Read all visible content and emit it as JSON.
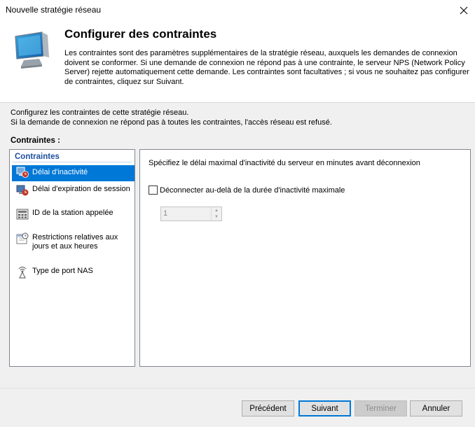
{
  "window": {
    "title": "Nouvelle stratégie réseau"
  },
  "header": {
    "title": "Configurer des contraintes",
    "description": "Les contraintes sont des paramètres supplémentaires de la stratégie réseau, auxquels les demandes de connexion doivent se conformer. Si une demande de connexion ne répond pas à une contrainte, le serveur NPS (Network Policy Server) rejette automatiquement cette demande. Les contraintes sont facultatives ; si vous ne souhaitez pas configurer de contraintes, cliquez sur Suivant.",
    "icon": "network-computer-icon"
  },
  "intro": {
    "line1": "Configurez les contraintes de cette stratégie réseau.",
    "line2": "Si la demande de connexion ne répond pas à toutes les contraintes, l'accès réseau est refusé."
  },
  "constraints": {
    "label": "Contraintes :",
    "group_label": "Contraintes",
    "items": [
      {
        "label": "Délai d'inactivité",
        "icon": "idle-timeout-icon",
        "selected": true
      },
      {
        "label": "Délai d'expiration de session",
        "icon": "session-timeout-icon",
        "selected": false
      },
      {
        "label": "ID de la station appelée",
        "icon": "called-station-icon",
        "selected": false
      },
      {
        "label": "Restrictions relatives aux jours et aux heures",
        "icon": "day-time-icon",
        "selected": false
      },
      {
        "label": "Type de port NAS",
        "icon": "nas-port-icon",
        "selected": false
      }
    ]
  },
  "detail": {
    "prompt": "Spécifiez le délai maximal d'inactivité du serveur en minutes avant déconnexion",
    "checkbox_label": "Déconnecter au-delà de la durée d'inactivité maximale",
    "checkbox_checked": false,
    "spinner_value": "1"
  },
  "buttons": {
    "previous": "Précédent",
    "next": "Suivant",
    "finish": "Terminer",
    "cancel": "Annuler"
  },
  "colors": {
    "selection": "#0078d7",
    "group_header": "#1f4e9d",
    "body_bg": "#f0f0f0"
  }
}
